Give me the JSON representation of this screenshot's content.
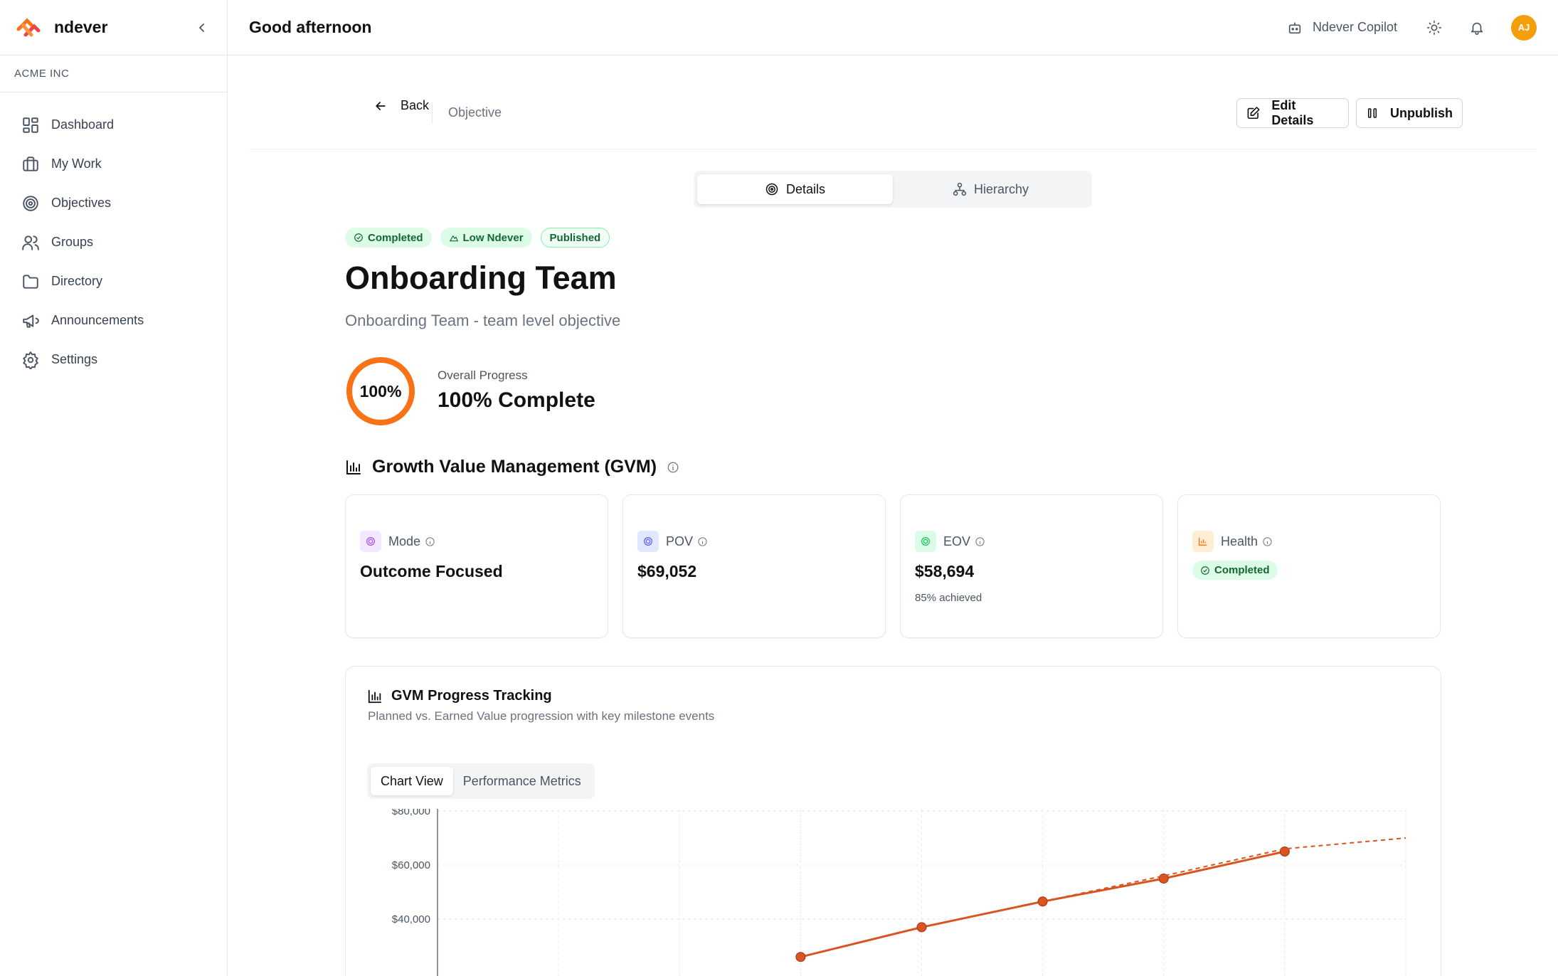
{
  "app": {
    "name": "ndever",
    "org": "ACME INC"
  },
  "sidebar": {
    "items": [
      {
        "label": "Dashboard",
        "icon": "dashboard-icon"
      },
      {
        "label": "My Work",
        "icon": "briefcase-icon"
      },
      {
        "label": "Objectives",
        "icon": "target-icon"
      },
      {
        "label": "Groups",
        "icon": "users-icon"
      },
      {
        "label": "Directory",
        "icon": "folder-icon"
      },
      {
        "label": "Announcements",
        "icon": "megaphone-icon"
      },
      {
        "label": "Settings",
        "icon": "gear-icon"
      }
    ]
  },
  "header": {
    "greeting": "Good afternoon",
    "copilot": "Ndever Copilot",
    "avatar_initials": "AJ",
    "avatar_color": "#f59e0b"
  },
  "subbar": {
    "back_label": "Back",
    "breadcrumb": "Objective",
    "edit_label": "Edit Details",
    "unpublish_label": "Unpublish"
  },
  "tabs": {
    "details": "Details",
    "hierarchy": "Hierarchy"
  },
  "objective": {
    "badges": {
      "status": "Completed",
      "risk": "Low Ndever",
      "publish": "Published"
    },
    "title": "Onboarding Team",
    "subtitle": "Onboarding Team - team level objective",
    "progress_percent": 100,
    "progress_ring_label": "100%",
    "progress_label": "Overall Progress",
    "progress_value": "100% Complete"
  },
  "gvm": {
    "title": "Growth Value Management (GVM)",
    "cards": {
      "mode": {
        "label": "Mode",
        "value": "Outcome Focused",
        "color": "#a855f7"
      },
      "pov": {
        "label": "POV",
        "value": "$69,052",
        "color": "#6366f1"
      },
      "eov": {
        "label": "EOV",
        "value": "$58,694",
        "sub": "85% achieved",
        "color": "#22c55e"
      },
      "health": {
        "label": "Health",
        "value": "Completed",
        "color": "#f97316"
      }
    }
  },
  "tracking": {
    "title": "GVM Progress Tracking",
    "subtitle": "Planned vs. Earned Value progression with key milestone events",
    "tabs": {
      "chart": "Chart View",
      "metrics": "Performance Metrics"
    }
  },
  "chart_data": {
    "type": "line",
    "y_ticks": [
      "$80,000",
      "$60,000",
      "$40,000"
    ],
    "ylim": [
      0,
      80000
    ],
    "grid": true,
    "accent": "#d9541e",
    "series": [
      {
        "style": "solid",
        "values": [
          null,
          null,
          null,
          26000,
          37000,
          46500,
          55000,
          65000,
          null
        ]
      },
      {
        "style": "dashed",
        "values": [
          null,
          null,
          null,
          null,
          null,
          46500,
          56000,
          66000,
          70000
        ]
      }
    ]
  }
}
